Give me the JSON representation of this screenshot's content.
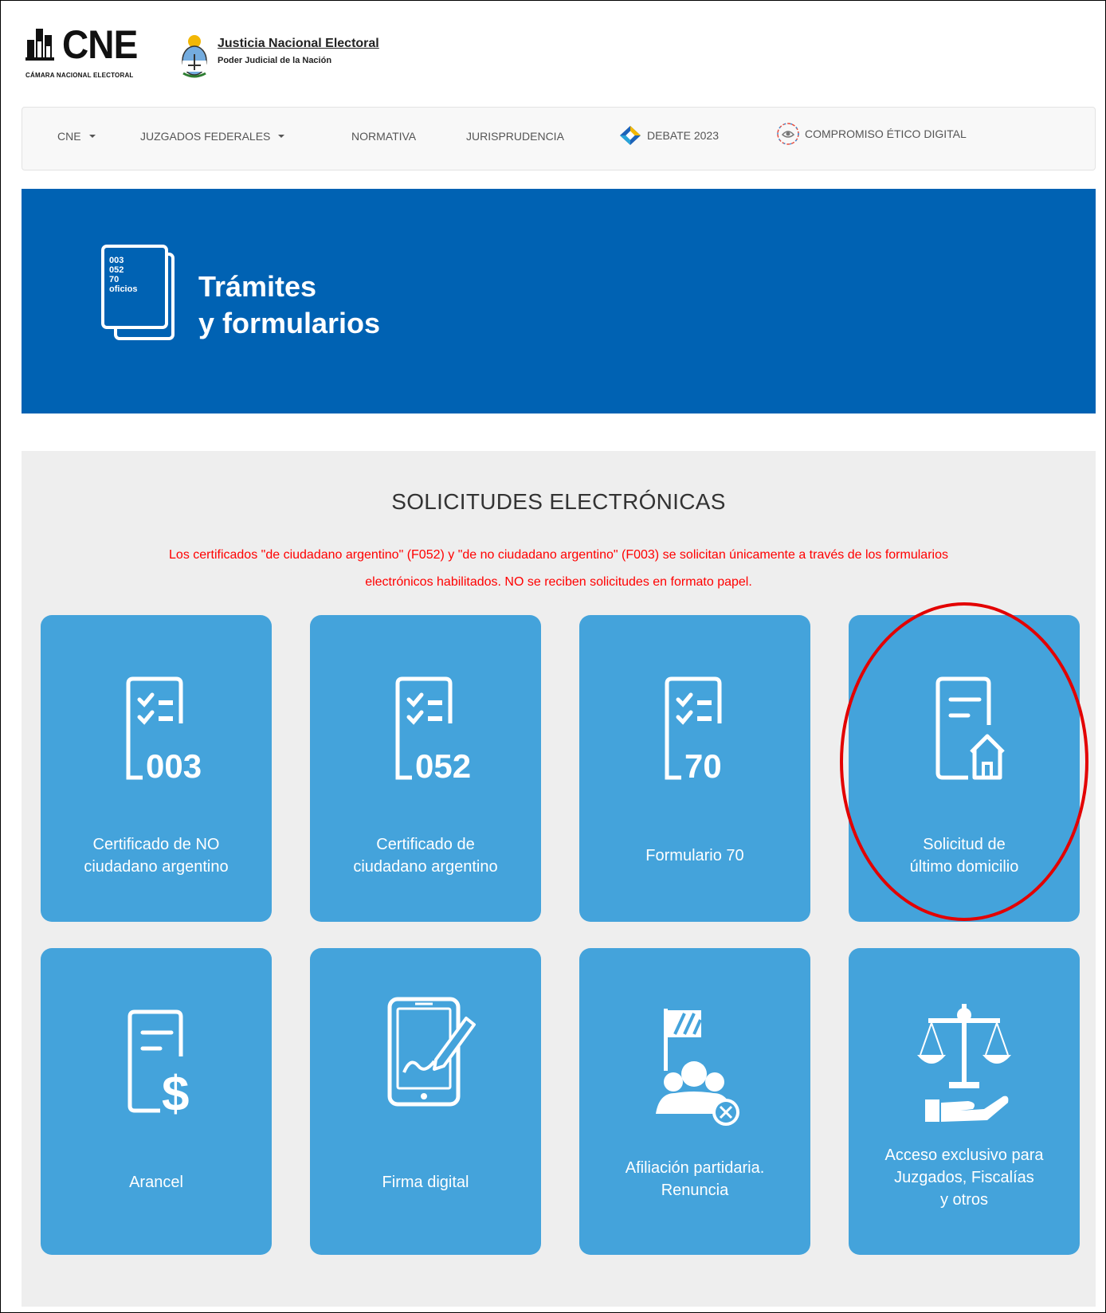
{
  "header": {
    "cne_logo_text": "CNE",
    "cne_logo_subtitle": "CÁMARA NACIONAL ELECTORAL",
    "jne_title": "Justicia Nacional Electoral",
    "jne_subtitle": "Poder Judicial de la Nación"
  },
  "nav": {
    "items": [
      {
        "label": "CNE",
        "dropdown": true
      },
      {
        "label": "JUZGADOS FEDERALES",
        "dropdown": true
      },
      {
        "label": "NORMATIVA",
        "dropdown": false
      },
      {
        "label": "JURISPRUDENCIA",
        "dropdown": false
      },
      {
        "label": "DEBATE 2023",
        "icon": "debate-diamond-icon"
      },
      {
        "label": "COMPROMISO ÉTICO DIGITAL",
        "icon": "compromiso-etico-icon"
      }
    ]
  },
  "hero": {
    "icon_lines": [
      "003",
      "052",
      "70",
      "oficios"
    ],
    "title_line1": "Trámites",
    "title_line2": "y formularios",
    "background": "#0062b3"
  },
  "section": {
    "title": "SOLICITUDES ELECTRÓNICAS",
    "notice_line1": "Los certificados \"de ciudadano argentino\" (F052) y \"de no ciudadano argentino\" (F003) se solicitan únicamente a través de los formularios",
    "notice_line2": "electrónicos habilitados. NO se reciben solicitudes en formato papel.",
    "notice_color": "#ff0000"
  },
  "cards": [
    {
      "icon": "form-003-icon",
      "number": "003",
      "line1": "Certificado de NO",
      "line2": "ciudadano argentino"
    },
    {
      "icon": "form-052-icon",
      "number": "052",
      "line1": "Certificado de",
      "line2": "ciudadano argentino"
    },
    {
      "icon": "form-70-icon",
      "number": "70",
      "line1": "Formulario 70"
    },
    {
      "icon": "document-house-icon",
      "line1": "Solicitud de",
      "line2": "último domicilio",
      "highlighted": true
    },
    {
      "icon": "document-dollar-icon",
      "line1": "Arancel"
    },
    {
      "icon": "tablet-signature-icon",
      "line1": "Firma digital"
    },
    {
      "icon": "flag-group-remove-icon",
      "line1": "Afiliación partidaria.",
      "line2": "Renuncia"
    },
    {
      "icon": "scales-hand-icon",
      "line1": "Acceso exclusivo para",
      "line2": "Juzgados, Fiscalías",
      "line3": "y otros"
    }
  ],
  "colors": {
    "card_bg": "#44a3db",
    "section_bg": "#eeeeee",
    "highlight": "#e30000"
  }
}
